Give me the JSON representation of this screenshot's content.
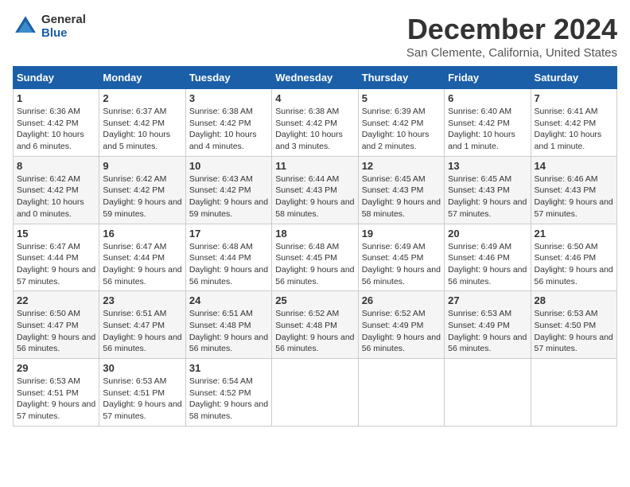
{
  "logo": {
    "line1": "General",
    "line2": "Blue"
  },
  "title": "December 2024",
  "subtitle": "San Clemente, California, United States",
  "headers": [
    "Sunday",
    "Monday",
    "Tuesday",
    "Wednesday",
    "Thursday",
    "Friday",
    "Saturday"
  ],
  "weeks": [
    [
      {
        "day": "1",
        "sunrise": "Sunrise: 6:36 AM",
        "sunset": "Sunset: 4:42 PM",
        "daylight": "Daylight: 10 hours and 6 minutes."
      },
      {
        "day": "2",
        "sunrise": "Sunrise: 6:37 AM",
        "sunset": "Sunset: 4:42 PM",
        "daylight": "Daylight: 10 hours and 5 minutes."
      },
      {
        "day": "3",
        "sunrise": "Sunrise: 6:38 AM",
        "sunset": "Sunset: 4:42 PM",
        "daylight": "Daylight: 10 hours and 4 minutes."
      },
      {
        "day": "4",
        "sunrise": "Sunrise: 6:38 AM",
        "sunset": "Sunset: 4:42 PM",
        "daylight": "Daylight: 10 hours and 3 minutes."
      },
      {
        "day": "5",
        "sunrise": "Sunrise: 6:39 AM",
        "sunset": "Sunset: 4:42 PM",
        "daylight": "Daylight: 10 hours and 2 minutes."
      },
      {
        "day": "6",
        "sunrise": "Sunrise: 6:40 AM",
        "sunset": "Sunset: 4:42 PM",
        "daylight": "Daylight: 10 hours and 1 minute."
      },
      {
        "day": "7",
        "sunrise": "Sunrise: 6:41 AM",
        "sunset": "Sunset: 4:42 PM",
        "daylight": "Daylight: 10 hours and 1 minute."
      }
    ],
    [
      {
        "day": "8",
        "sunrise": "Sunrise: 6:42 AM",
        "sunset": "Sunset: 4:42 PM",
        "daylight": "Daylight: 10 hours and 0 minutes."
      },
      {
        "day": "9",
        "sunrise": "Sunrise: 6:42 AM",
        "sunset": "Sunset: 4:42 PM",
        "daylight": "Daylight: 9 hours and 59 minutes."
      },
      {
        "day": "10",
        "sunrise": "Sunrise: 6:43 AM",
        "sunset": "Sunset: 4:42 PM",
        "daylight": "Daylight: 9 hours and 59 minutes."
      },
      {
        "day": "11",
        "sunrise": "Sunrise: 6:44 AM",
        "sunset": "Sunset: 4:43 PM",
        "daylight": "Daylight: 9 hours and 58 minutes."
      },
      {
        "day": "12",
        "sunrise": "Sunrise: 6:45 AM",
        "sunset": "Sunset: 4:43 PM",
        "daylight": "Daylight: 9 hours and 58 minutes."
      },
      {
        "day": "13",
        "sunrise": "Sunrise: 6:45 AM",
        "sunset": "Sunset: 4:43 PM",
        "daylight": "Daylight: 9 hours and 57 minutes."
      },
      {
        "day": "14",
        "sunrise": "Sunrise: 6:46 AM",
        "sunset": "Sunset: 4:43 PM",
        "daylight": "Daylight: 9 hours and 57 minutes."
      }
    ],
    [
      {
        "day": "15",
        "sunrise": "Sunrise: 6:47 AM",
        "sunset": "Sunset: 4:44 PM",
        "daylight": "Daylight: 9 hours and 57 minutes."
      },
      {
        "day": "16",
        "sunrise": "Sunrise: 6:47 AM",
        "sunset": "Sunset: 4:44 PM",
        "daylight": "Daylight: 9 hours and 56 minutes."
      },
      {
        "day": "17",
        "sunrise": "Sunrise: 6:48 AM",
        "sunset": "Sunset: 4:44 PM",
        "daylight": "Daylight: 9 hours and 56 minutes."
      },
      {
        "day": "18",
        "sunrise": "Sunrise: 6:48 AM",
        "sunset": "Sunset: 4:45 PM",
        "daylight": "Daylight: 9 hours and 56 minutes."
      },
      {
        "day": "19",
        "sunrise": "Sunrise: 6:49 AM",
        "sunset": "Sunset: 4:45 PM",
        "daylight": "Daylight: 9 hours and 56 minutes."
      },
      {
        "day": "20",
        "sunrise": "Sunrise: 6:49 AM",
        "sunset": "Sunset: 4:46 PM",
        "daylight": "Daylight: 9 hours and 56 minutes."
      },
      {
        "day": "21",
        "sunrise": "Sunrise: 6:50 AM",
        "sunset": "Sunset: 4:46 PM",
        "daylight": "Daylight: 9 hours and 56 minutes."
      }
    ],
    [
      {
        "day": "22",
        "sunrise": "Sunrise: 6:50 AM",
        "sunset": "Sunset: 4:47 PM",
        "daylight": "Daylight: 9 hours and 56 minutes."
      },
      {
        "day": "23",
        "sunrise": "Sunrise: 6:51 AM",
        "sunset": "Sunset: 4:47 PM",
        "daylight": "Daylight: 9 hours and 56 minutes."
      },
      {
        "day": "24",
        "sunrise": "Sunrise: 6:51 AM",
        "sunset": "Sunset: 4:48 PM",
        "daylight": "Daylight: 9 hours and 56 minutes."
      },
      {
        "day": "25",
        "sunrise": "Sunrise: 6:52 AM",
        "sunset": "Sunset: 4:48 PM",
        "daylight": "Daylight: 9 hours and 56 minutes."
      },
      {
        "day": "26",
        "sunrise": "Sunrise: 6:52 AM",
        "sunset": "Sunset: 4:49 PM",
        "daylight": "Daylight: 9 hours and 56 minutes."
      },
      {
        "day": "27",
        "sunrise": "Sunrise: 6:53 AM",
        "sunset": "Sunset: 4:49 PM",
        "daylight": "Daylight: 9 hours and 56 minutes."
      },
      {
        "day": "28",
        "sunrise": "Sunrise: 6:53 AM",
        "sunset": "Sunset: 4:50 PM",
        "daylight": "Daylight: 9 hours and 57 minutes."
      }
    ],
    [
      {
        "day": "29",
        "sunrise": "Sunrise: 6:53 AM",
        "sunset": "Sunset: 4:51 PM",
        "daylight": "Daylight: 9 hours and 57 minutes."
      },
      {
        "day": "30",
        "sunrise": "Sunrise: 6:53 AM",
        "sunset": "Sunset: 4:51 PM",
        "daylight": "Daylight: 9 hours and 57 minutes."
      },
      {
        "day": "31",
        "sunrise": "Sunrise: 6:54 AM",
        "sunset": "Sunset: 4:52 PM",
        "daylight": "Daylight: 9 hours and 58 minutes."
      },
      null,
      null,
      null,
      null
    ]
  ]
}
